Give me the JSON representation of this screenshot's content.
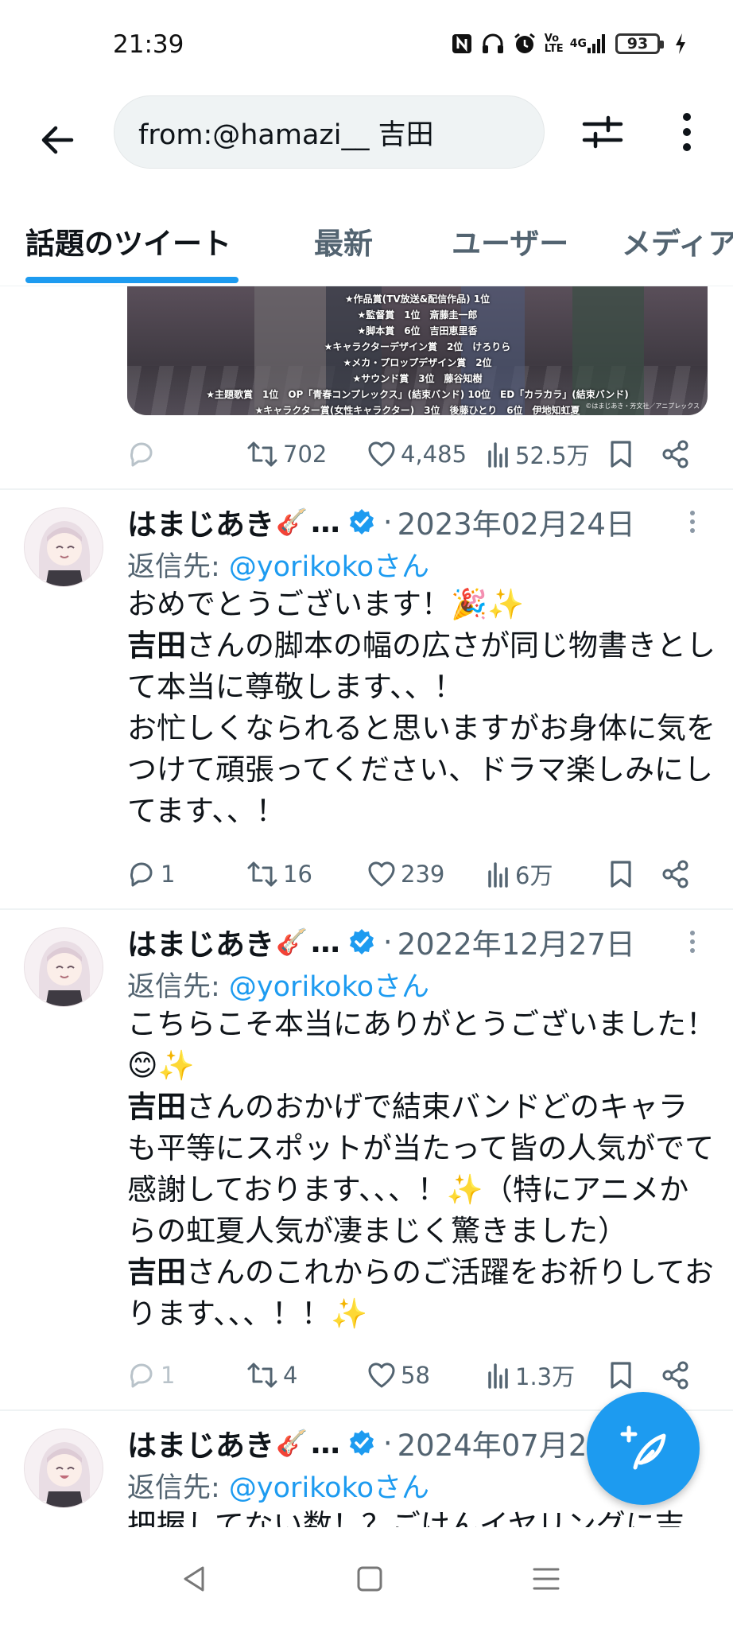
{
  "status_bar": {
    "time": "21:39",
    "icons": [
      "nfc-icon",
      "headphones-icon",
      "alarm-icon",
      "volte-icon",
      "signal-4g-icon",
      "battery-icon",
      "charging-icon"
    ],
    "volte_label": "Vo\nLTE",
    "network_label": "4G",
    "battery_level": "93"
  },
  "header": {
    "back_icon": "arrow-left-icon",
    "search_query": "from:@hamazi__ 吉田",
    "filter_icon": "sliders-icon",
    "more_icon": "more-vertical-icon"
  },
  "tabs": [
    {
      "label": "話題のツイート",
      "active": true
    },
    {
      "label": "最新",
      "active": false
    },
    {
      "label": "ユーザー",
      "active": false
    },
    {
      "label": "メディア",
      "active": false
    }
  ],
  "media_card": {
    "lines": [
      "★作品賞(TV放送&配信作品) 1位",
      "★監督賞　1位　斎藤圭一郎",
      "★脚本賞　6位　吉田恵里香",
      "★キャラクターデザイン賞　2位　けろりら",
      "★メカ・プロップデザイン賞　2位",
      "★サウンド賞　3位　藤谷知樹",
      "★主題歌賞　1位　OP「青春コンプレックス」(結束バンド) 10位　ED「カラカラ」(結束バンド)",
      "★キャラクター賞(女性キャラクター)　3位　後藤ひとり　6位　伊地知虹夏"
    ],
    "credit": "©はまじあき・芳文社／アニプレックス"
  },
  "first_actions": {
    "reply": "",
    "retweet": "702",
    "like": "4,485",
    "views": "52.5万"
  },
  "tweets": [
    {
      "name": "はまじあき",
      "guitar": "🎸",
      "ellipsis": "…",
      "dot": "·",
      "date": "2023年02月24日",
      "reply_prefix": "返信先: ",
      "reply_handle": "@yorikokoさん",
      "body": [
        [
          {
            "t": "おめでとうございます！🎉✨"
          }
        ],
        [
          {
            "t": "吉田",
            "b": true
          },
          {
            "t": "さんの脚本の幅の広さが同じ物書きとして本当に尊敬します、、！"
          }
        ],
        [
          {
            "t": "お忙しくなられると思いますがお身体に気をつけて頑張ってください、ドラマ楽しみにしてます、、！"
          }
        ]
      ],
      "actions": {
        "reply": "1",
        "retweet": "16",
        "like": "239",
        "views": "6万"
      }
    },
    {
      "name": "はまじあき",
      "guitar": "🎸",
      "ellipsis": "…",
      "dot": "·",
      "date": "2022年12月27日",
      "reply_prefix": "返信先: ",
      "reply_handle": "@yorikokoさん",
      "body": [
        [
          {
            "t": "こちらこそ本当にありがとうございました！😊✨"
          }
        ],
        [
          {
            "t": "吉田",
            "b": true
          },
          {
            "t": "さんのおかげで結束バンドどのキャラも平等にスポットが当たって皆の人気がでて感謝しております、、、！✨（特にアニメからの虹夏人気が凄まじく驚きました）"
          }
        ],
        [
          {
            "t": "吉田",
            "b": true
          },
          {
            "t": "さんのこれからのご活躍をお祈りしております、、、！！✨"
          }
        ]
      ],
      "actions": {
        "reply": "1",
        "retweet": "4",
        "like": "58",
        "views": "1.3万"
      }
    },
    {
      "name": "はまじあき",
      "guitar": "🎸",
      "ellipsis": "…",
      "dot": "·",
      "date": "2024年07月2",
      "reply_prefix": "返信先: ",
      "reply_handle": "@yorikokoさん",
      "body": [
        [
          {
            "t": "把握してない数！？ごけんイヤリングに吉"
          }
        ]
      ],
      "actions": null
    }
  ],
  "fab": {
    "icon": "compose-icon"
  },
  "system_nav": {
    "icons": [
      "nav-back-icon",
      "nav-home-icon",
      "nav-menu-icon"
    ]
  }
}
